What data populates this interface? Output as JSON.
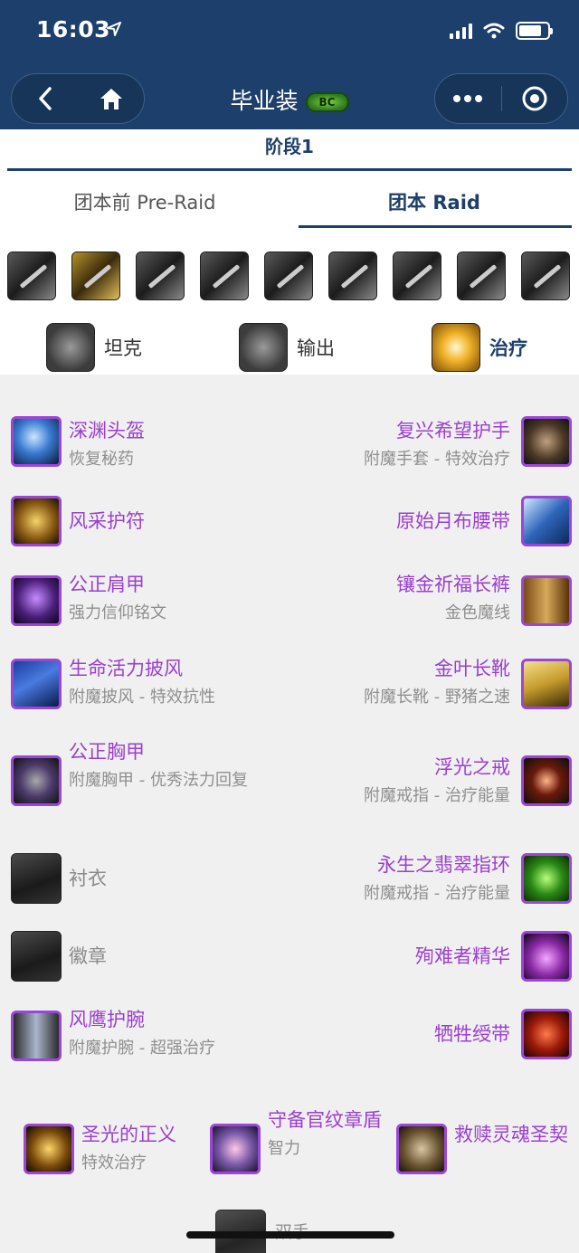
{
  "status": {
    "time": "16:03"
  },
  "nav": {
    "title": "毕业装",
    "badge": "BC"
  },
  "phase": {
    "label": "阶段1"
  },
  "tabs": [
    {
      "label": "团本前 Pre-Raid"
    },
    {
      "label": "团本 Raid",
      "active": true
    }
  ],
  "class_icons": [
    "warrior-icon",
    "paladin-icon",
    "hunter-icon",
    "rogue-icon",
    "priest-icon",
    "shaman-icon",
    "mage-icon",
    "warlock-icon",
    "druid-icon"
  ],
  "roles": [
    {
      "label": "坦克",
      "icon": "shield-icon"
    },
    {
      "label": "输出",
      "icon": "hammer-icon"
    },
    {
      "label": "治疗",
      "icon": "holy-light-icon",
      "active": true
    }
  ],
  "gear_left": [
    {
      "name": "深渊头盔",
      "note": "恢复秘药"
    },
    {
      "name": "风采护符",
      "note": ""
    },
    {
      "name": "公正肩甲",
      "note": "强力信仰铭文"
    },
    {
      "name": "生命活力披风",
      "note": "附魔披风 - 特效抗性"
    },
    {
      "name": "公正胸甲",
      "note": "附魔胸甲 - 优秀法力回复"
    },
    {
      "name": "衬衣",
      "note": ""
    },
    {
      "name": "徽章",
      "note": ""
    },
    {
      "name": "风鹰护腕",
      "note": "附魔护腕 - 超强治疗"
    }
  ],
  "gear_right": [
    {
      "name": "复兴希望护手",
      "note": "附魔手套 - 特效治疗"
    },
    {
      "name": "原始月布腰带",
      "note": ""
    },
    {
      "name": "镶金祈福长裤",
      "note": "金色魔线"
    },
    {
      "name": "金叶长靴",
      "note": "附魔长靴 - 野猪之速"
    },
    {
      "name": "浮光之戒",
      "note": "附魔戒指 - 治疗能量"
    },
    {
      "name": "永生之翡翠指环",
      "note": "附魔戒指 - 治疗能量"
    },
    {
      "name": "殉难者精华",
      "note": ""
    },
    {
      "name": "牺牲绶带",
      "note": ""
    }
  ],
  "gear_bottom": [
    {
      "name": "圣光的正义",
      "note": "特效治疗"
    },
    {
      "name": "守备官纹章盾",
      "note": "智力"
    },
    {
      "name": "救赎灵魂圣契",
      "note": ""
    }
  ],
  "gear_partial": {
    "name": "双手"
  }
}
